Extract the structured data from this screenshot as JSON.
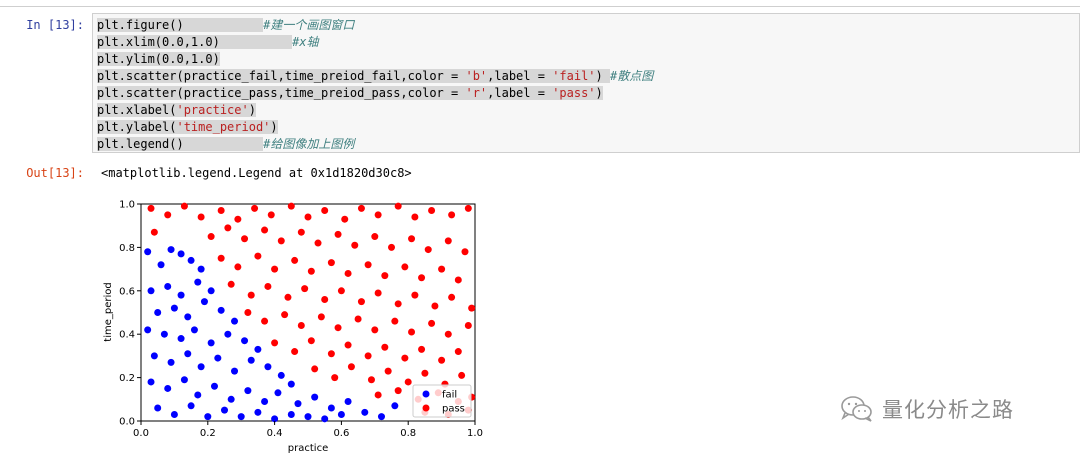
{
  "notebook": {
    "in_prompt": "In [13]:",
    "out_prompt": "Out[13]:",
    "code_lines": [
      [
        {
          "t": "plt.figure()           "
        },
        {
          "t": "#建一个画图窗口",
          "c": "cmt"
        }
      ],
      [
        {
          "t": "plt.xlim(0.0,1.0)          "
        },
        {
          "t": "#x轴",
          "c": "cmt"
        }
      ],
      [
        {
          "t": "plt.ylim(0.0,1.0)"
        }
      ],
      [
        {
          "t": "plt.scatter(practice_fail,time_preiod_fail,color = "
        },
        {
          "t": "'b'",
          "c": "str"
        },
        {
          "t": ",label = "
        },
        {
          "t": "'fail'",
          "c": "str"
        },
        {
          "t": ") "
        },
        {
          "t": "#散点图",
          "c": "cmt"
        }
      ],
      [
        {
          "t": "plt.scatter(practice_pass,time_preiod_pass,color = "
        },
        {
          "t": "'r'",
          "c": "str"
        },
        {
          "t": ",label = "
        },
        {
          "t": "'pass'",
          "c": "str"
        },
        {
          "t": ")"
        }
      ],
      [
        {
          "t": "plt.xlabel("
        },
        {
          "t": "'practice'",
          "c": "str"
        },
        {
          "t": ")"
        }
      ],
      [
        {
          "t": "plt.ylabel("
        },
        {
          "t": "'time_period'",
          "c": "str"
        },
        {
          "t": ")"
        }
      ],
      [
        {
          "t": "plt.legend()           "
        },
        {
          "t": "#给图像加上图例",
          "c": "cmt"
        }
      ]
    ],
    "output_text": "<matplotlib.legend.Legend at 0x1d1820d30c8>"
  },
  "chart_data": {
    "type": "scatter",
    "xlabel": "practice",
    "ylabel": "time_period",
    "xlim": [
      0.0,
      1.0
    ],
    "ylim": [
      0.0,
      1.0
    ],
    "xticks": [
      "0.0",
      "0.2",
      "0.4",
      "0.6",
      "0.8",
      "1.0"
    ],
    "yticks": [
      "0.0",
      "0.2",
      "0.4",
      "0.6",
      "0.8",
      "1.0"
    ],
    "legend_position": "lower-right",
    "series": [
      {
        "name": "fail",
        "color": "#0000ff",
        "points": [
          [
            0.02,
            0.78
          ],
          [
            0.06,
            0.72
          ],
          [
            0.09,
            0.79
          ],
          [
            0.12,
            0.77
          ],
          [
            0.15,
            0.74
          ],
          [
            0.18,
            0.7
          ],
          [
            0.03,
            0.6
          ],
          [
            0.08,
            0.62
          ],
          [
            0.12,
            0.58
          ],
          [
            0.17,
            0.64
          ],
          [
            0.21,
            0.6
          ],
          [
            0.05,
            0.5
          ],
          [
            0.1,
            0.52
          ],
          [
            0.14,
            0.48
          ],
          [
            0.19,
            0.55
          ],
          [
            0.24,
            0.51
          ],
          [
            0.28,
            0.46
          ],
          [
            0.02,
            0.42
          ],
          [
            0.07,
            0.4
          ],
          [
            0.12,
            0.38
          ],
          [
            0.16,
            0.42
          ],
          [
            0.21,
            0.36
          ],
          [
            0.26,
            0.4
          ],
          [
            0.31,
            0.37
          ],
          [
            0.35,
            0.33
          ],
          [
            0.04,
            0.3
          ],
          [
            0.09,
            0.27
          ],
          [
            0.14,
            0.31
          ],
          [
            0.18,
            0.25
          ],
          [
            0.23,
            0.29
          ],
          [
            0.28,
            0.23
          ],
          [
            0.33,
            0.28
          ],
          [
            0.38,
            0.25
          ],
          [
            0.42,
            0.21
          ],
          [
            0.45,
            0.17
          ],
          [
            0.03,
            0.18
          ],
          [
            0.08,
            0.15
          ],
          [
            0.13,
            0.19
          ],
          [
            0.17,
            0.12
          ],
          [
            0.22,
            0.16
          ],
          [
            0.27,
            0.1
          ],
          [
            0.32,
            0.14
          ],
          [
            0.37,
            0.09
          ],
          [
            0.41,
            0.13
          ],
          [
            0.47,
            0.08
          ],
          [
            0.52,
            0.11
          ],
          [
            0.57,
            0.06
          ],
          [
            0.62,
            0.09
          ],
          [
            0.67,
            0.04
          ],
          [
            0.05,
            0.06
          ],
          [
            0.1,
            0.03
          ],
          [
            0.15,
            0.07
          ],
          [
            0.2,
            0.02
          ],
          [
            0.25,
            0.05
          ],
          [
            0.3,
            0.02
          ],
          [
            0.35,
            0.04
          ],
          [
            0.4,
            0.01
          ],
          [
            0.45,
            0.03
          ],
          [
            0.5,
            0.02
          ],
          [
            0.55,
            0.01
          ],
          [
            0.6,
            0.03
          ],
          [
            0.72,
            0.02
          ],
          [
            0.76,
            0.07
          ]
        ]
      },
      {
        "name": "pass",
        "color": "#ff0000",
        "points": [
          [
            0.03,
            0.98
          ],
          [
            0.08,
            0.95
          ],
          [
            0.13,
            0.99
          ],
          [
            0.18,
            0.94
          ],
          [
            0.24,
            0.97
          ],
          [
            0.29,
            0.93
          ],
          [
            0.34,
            0.98
          ],
          [
            0.39,
            0.95
          ],
          [
            0.45,
            0.99
          ],
          [
            0.5,
            0.94
          ],
          [
            0.55,
            0.97
          ],
          [
            0.61,
            0.93
          ],
          [
            0.66,
            0.98
          ],
          [
            0.71,
            0.95
          ],
          [
            0.77,
            0.99
          ],
          [
            0.82,
            0.94
          ],
          [
            0.87,
            0.97
          ],
          [
            0.93,
            0.95
          ],
          [
            0.98,
            0.98
          ],
          [
            0.04,
            0.87
          ],
          [
            0.21,
            0.85
          ],
          [
            0.26,
            0.89
          ],
          [
            0.31,
            0.84
          ],
          [
            0.37,
            0.88
          ],
          [
            0.42,
            0.83
          ],
          [
            0.48,
            0.87
          ],
          [
            0.53,
            0.82
          ],
          [
            0.59,
            0.86
          ],
          [
            0.64,
            0.81
          ],
          [
            0.7,
            0.85
          ],
          [
            0.75,
            0.8
          ],
          [
            0.81,
            0.84
          ],
          [
            0.86,
            0.79
          ],
          [
            0.92,
            0.83
          ],
          [
            0.97,
            0.78
          ],
          [
            0.24,
            0.75
          ],
          [
            0.29,
            0.71
          ],
          [
            0.35,
            0.76
          ],
          [
            0.4,
            0.7
          ],
          [
            0.46,
            0.74
          ],
          [
            0.51,
            0.69
          ],
          [
            0.57,
            0.73
          ],
          [
            0.62,
            0.68
          ],
          [
            0.68,
            0.72
          ],
          [
            0.73,
            0.67
          ],
          [
            0.79,
            0.71
          ],
          [
            0.84,
            0.66
          ],
          [
            0.9,
            0.7
          ],
          [
            0.95,
            0.65
          ],
          [
            0.27,
            0.63
          ],
          [
            0.33,
            0.58
          ],
          [
            0.38,
            0.62
          ],
          [
            0.44,
            0.57
          ],
          [
            0.49,
            0.61
          ],
          [
            0.55,
            0.56
          ],
          [
            0.6,
            0.6
          ],
          [
            0.66,
            0.55
          ],
          [
            0.71,
            0.59
          ],
          [
            0.77,
            0.54
          ],
          [
            0.82,
            0.58
          ],
          [
            0.88,
            0.53
          ],
          [
            0.93,
            0.57
          ],
          [
            0.99,
            0.52
          ],
          [
            0.32,
            0.5
          ],
          [
            0.37,
            0.46
          ],
          [
            0.43,
            0.49
          ],
          [
            0.48,
            0.44
          ],
          [
            0.54,
            0.48
          ],
          [
            0.59,
            0.43
          ],
          [
            0.65,
            0.47
          ],
          [
            0.7,
            0.42
          ],
          [
            0.76,
            0.46
          ],
          [
            0.81,
            0.41
          ],
          [
            0.87,
            0.45
          ],
          [
            0.92,
            0.4
          ],
          [
            0.98,
            0.44
          ],
          [
            0.4,
            0.36
          ],
          [
            0.46,
            0.32
          ],
          [
            0.51,
            0.37
          ],
          [
            0.57,
            0.31
          ],
          [
            0.62,
            0.35
          ],
          [
            0.68,
            0.3
          ],
          [
            0.73,
            0.34
          ],
          [
            0.79,
            0.29
          ],
          [
            0.84,
            0.33
          ],
          [
            0.9,
            0.28
          ],
          [
            0.95,
            0.32
          ],
          [
            0.52,
            0.24
          ],
          [
            0.58,
            0.2
          ],
          [
            0.63,
            0.25
          ],
          [
            0.69,
            0.19
          ],
          [
            0.74,
            0.23
          ],
          [
            0.8,
            0.18
          ],
          [
            0.85,
            0.22
          ],
          [
            0.91,
            0.17
          ],
          [
            0.96,
            0.21
          ],
          [
            0.71,
            0.12
          ],
          [
            0.77,
            0.14
          ],
          [
            0.83,
            0.1
          ],
          [
            0.89,
            0.13
          ],
          [
            0.95,
            0.09
          ],
          [
            0.99,
            0.11
          ],
          [
            0.85,
            0.04
          ],
          [
            0.92,
            0.03
          ],
          [
            0.98,
            0.05
          ]
        ]
      }
    ]
  },
  "watermark": {
    "text": "量化分析之路",
    "icon": "wechat-icon"
  }
}
